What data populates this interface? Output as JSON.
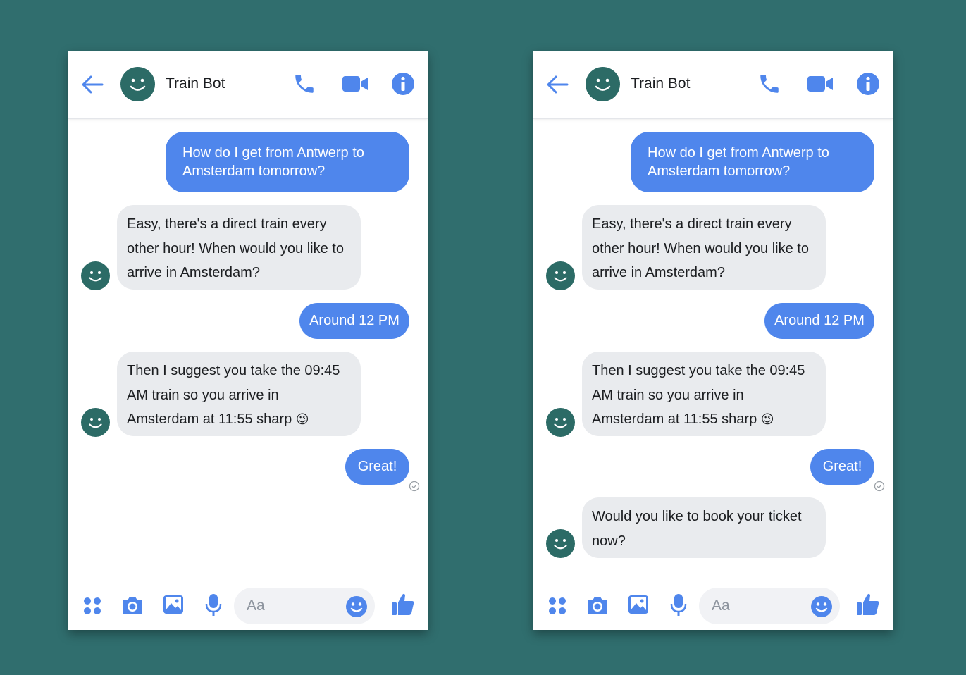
{
  "colors": {
    "background": "#306e6e",
    "accent": "#4f86ec",
    "avatar": "#2c6b66",
    "incoming_bubble": "#e9ebee"
  },
  "screens": [
    {
      "header": {
        "title": "Train Bot"
      },
      "messages": [
        {
          "from": "user",
          "text": "How do I get from Antwerp to\nAmsterdam tomorrow?"
        },
        {
          "from": "bot",
          "text": "Easy, there's a direct train every\nother hour! When would you like to\narrive in Amsterdam?"
        },
        {
          "from": "user",
          "text": "Around 12 PM"
        },
        {
          "from": "bot",
          "text": "Then I suggest you take the 09:45\nAM train so you arrive in\nAmsterdam at 11:55 sharp",
          "emoji": "😉"
        },
        {
          "from": "user",
          "text": "Great!"
        }
      ],
      "composer": {
        "placeholder": "Aa"
      }
    },
    {
      "header": {
        "title": "Train Bot"
      },
      "messages": [
        {
          "from": "user",
          "text": "How do I get from Antwerp to\nAmsterdam tomorrow?"
        },
        {
          "from": "bot",
          "text": "Easy, there's a direct train every\nother hour! When would you like to\narrive in Amsterdam?"
        },
        {
          "from": "user",
          "text": "Around 12 PM"
        },
        {
          "from": "bot",
          "text": "Then I suggest you take the 09:45\nAM train so you arrive in\nAmsterdam at 11:55 sharp",
          "emoji": "😉"
        },
        {
          "from": "user",
          "text": "Great!"
        },
        {
          "from": "bot",
          "text": "Would you like to book your ticket\nnow?"
        }
      ],
      "composer": {
        "placeholder": "Aa"
      }
    }
  ],
  "icons": {
    "back": "back-arrow-icon",
    "call": "phone-icon",
    "video": "video-camera-icon",
    "info": "info-icon",
    "apps": "apps-grid-icon",
    "camera": "camera-icon",
    "gallery": "image-icon",
    "voice": "microphone-icon",
    "emoji": "emoji-icon",
    "like": "thumbs-up-icon",
    "read": "read-receipt-icon",
    "avatar": "smiley-avatar-icon"
  }
}
